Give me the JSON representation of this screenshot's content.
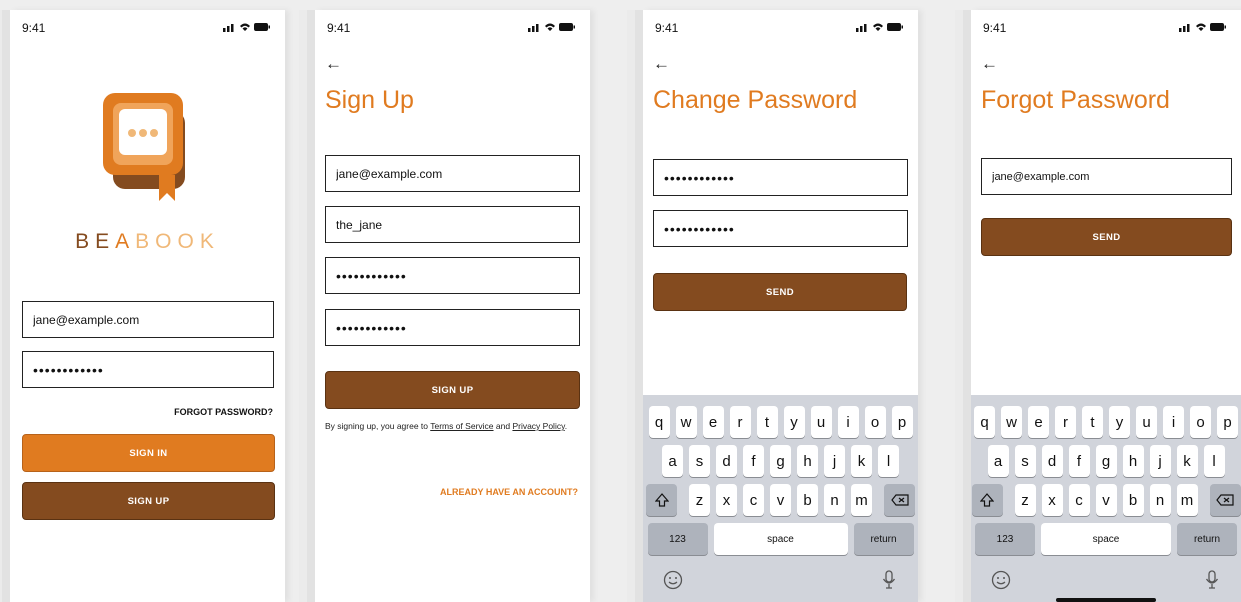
{
  "status_bar": {
    "time": "9:41"
  },
  "screen_signin": {
    "brand": {
      "part1": "BE",
      "part2": "A",
      "part3": "BOOK"
    },
    "email_value": "jane@example.com",
    "password_value": "••••••••••••",
    "forgot_label": "FORGOT PASSWORD?",
    "signin_label": "SIGN IN",
    "signup_label": "SIGN UP"
  },
  "screen_signup": {
    "back": "←",
    "title": "Sign Up",
    "email_value": "jane@example.com",
    "username_value": "the_jane",
    "password_value": "••••••••••••",
    "confirm_value": "••••••••••••",
    "signup_label": "SIGN UP",
    "terms_prefix": "By signing up, you agree to ",
    "terms_link": "Terms of Service",
    "terms_and": " and ",
    "privacy_link": "Privacy Policy",
    "terms_suffix": ".",
    "have_account_label": "ALREADY HAVE AN ACCOUNT?"
  },
  "screen_change": {
    "back": "←",
    "title": "Change Password",
    "password_value": "••••••••••••",
    "confirm_value": "••••••••••••",
    "send_label": "SEND"
  },
  "screen_forgot": {
    "back": "←",
    "title": "Forgot Password",
    "email_value": "jane@example.com",
    "send_label": "SEND"
  },
  "keyboard": {
    "row1": [
      "q",
      "w",
      "e",
      "r",
      "t",
      "y",
      "u",
      "i",
      "o",
      "p"
    ],
    "row2": [
      "a",
      "s",
      "d",
      "f",
      "g",
      "h",
      "j",
      "k",
      "l"
    ],
    "row3": [
      "z",
      "x",
      "c",
      "v",
      "b",
      "n",
      "m"
    ],
    "numbers_label": "123",
    "space_label": "space",
    "return_label": "return"
  },
  "colors": {
    "accent_orange": "#e07b20",
    "brown": "#844b1f",
    "keyboard_bg": "#d1d4db"
  }
}
